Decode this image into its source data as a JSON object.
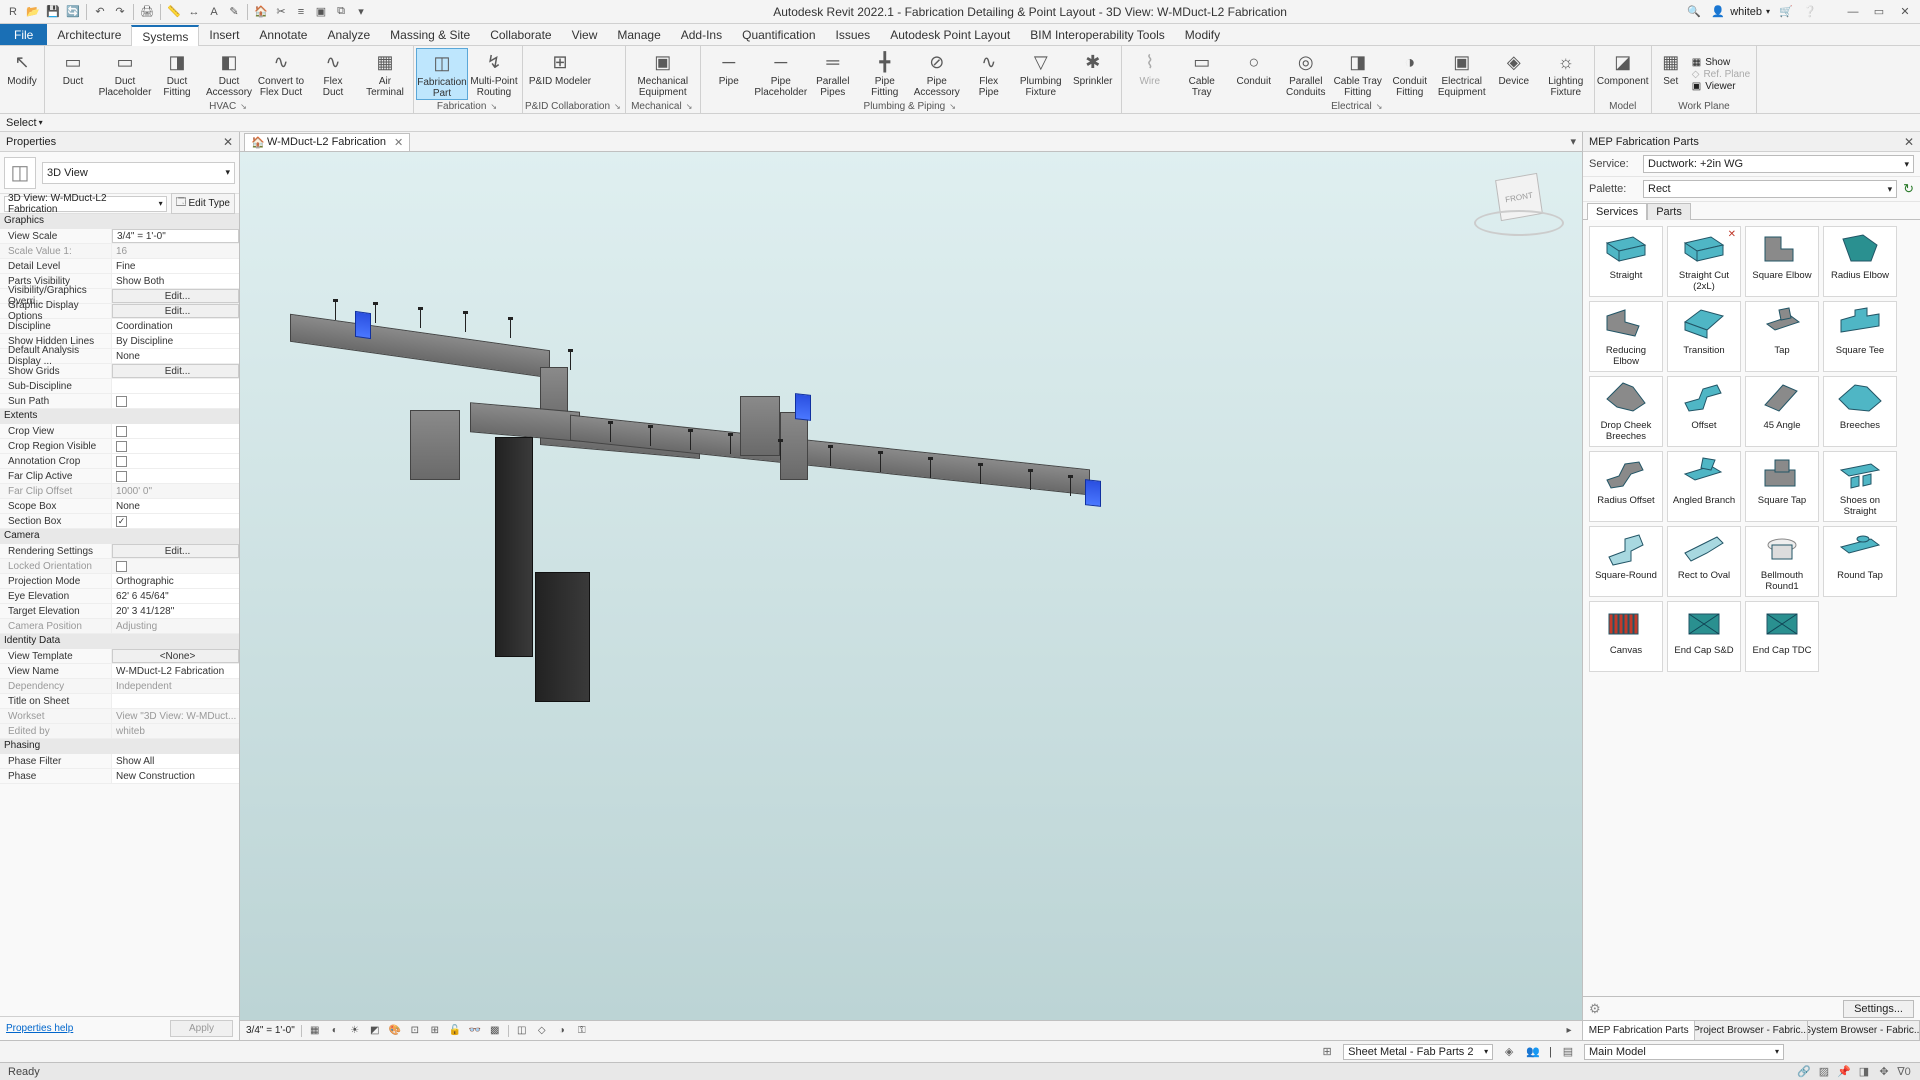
{
  "app": {
    "title": "Autodesk Revit 2022.1 - Fabrication Detailing & Point Layout - 3D View: W-MDuct-L2 Fabrication",
    "user": "whiteb"
  },
  "ribbon_tabs": [
    "Architecture",
    "Systems",
    "Insert",
    "Annotate",
    "Analyze",
    "Massing & Site",
    "Collaborate",
    "View",
    "Manage",
    "Add-Ins",
    "Quantification",
    "Issues",
    "Autodesk Point Layout",
    "BIM Interoperability Tools",
    "Modify"
  ],
  "active_tab": "Systems",
  "file_tab": "File",
  "options_bar": {
    "select": "Select"
  },
  "panels": [
    {
      "title": "HVAC",
      "launcher": true,
      "items": [
        {
          "label": "Duct",
          "glyph": "▭"
        },
        {
          "label": "Duct\nPlaceholder",
          "glyph": "▭"
        },
        {
          "label": "Duct\nFitting",
          "glyph": "◨"
        },
        {
          "label": "Duct\nAccessory",
          "glyph": "◧"
        },
        {
          "label": "Convert to\nFlex Duct",
          "glyph": "∿"
        },
        {
          "label": "Flex\nDuct",
          "glyph": "∿"
        },
        {
          "label": "Air\nTerminal",
          "glyph": "▦"
        }
      ]
    },
    {
      "title": "Fabrication",
      "launcher": true,
      "items": [
        {
          "label": "Fabrication\nPart",
          "glyph": "◫",
          "sel": true
        },
        {
          "label": "Multi-Point\nRouting",
          "glyph": "↯"
        }
      ]
    },
    {
      "title": "P&ID Collaboration",
      "launcher": true,
      "items": [
        {
          "label": "P&ID Modeler",
          "glyph": "⊞",
          "wide": true
        }
      ]
    },
    {
      "title": "Mechanical",
      "launcher": true,
      "items": [
        {
          "label": "Mechanical\nEquipment",
          "glyph": "▣",
          "wide": true
        }
      ]
    },
    {
      "title": "Plumbing & Piping",
      "launcher": true,
      "items": [
        {
          "label": "Pipe",
          "glyph": "─"
        },
        {
          "label": "Pipe\nPlaceholder",
          "glyph": "─"
        },
        {
          "label": "Parallel\nPipes",
          "glyph": "═"
        },
        {
          "label": "Pipe\nFitting",
          "glyph": "╋"
        },
        {
          "label": "Pipe\nAccessory",
          "glyph": "⊘"
        },
        {
          "label": "Flex\nPipe",
          "glyph": "∿"
        },
        {
          "label": "Plumbing\nFixture",
          "glyph": "▽"
        },
        {
          "label": "Sprinkler",
          "glyph": "✱"
        }
      ]
    },
    {
      "title": "Electrical",
      "launcher": true,
      "items": [
        {
          "label": "Wire",
          "glyph": "⌇",
          "disabled": true
        },
        {
          "label": "Cable\nTray",
          "glyph": "▭"
        },
        {
          "label": "Conduit",
          "glyph": "○"
        },
        {
          "label": "Parallel\nConduits",
          "glyph": "◎"
        },
        {
          "label": "Cable Tray\nFitting",
          "glyph": "◨"
        },
        {
          "label": "Conduit\nFitting",
          "glyph": "◑"
        },
        {
          "label": "Electrical\nEquipment",
          "glyph": "▣"
        },
        {
          "label": "Device",
          "glyph": "◈"
        },
        {
          "label": "Lighting\nFixture",
          "glyph": "☼"
        }
      ]
    },
    {
      "title": "Model",
      "items": [
        {
          "label": "Component",
          "glyph": "◪"
        }
      ]
    },
    {
      "title": "Work Plane",
      "items_small": [
        {
          "label": "Set",
          "glyph": "▦"
        },
        {
          "label": "Show",
          "glyph": "▦"
        },
        {
          "label": "Ref. Plane",
          "glyph": "◇",
          "disabled": true
        },
        {
          "label": "Viewer",
          "glyph": "▣"
        }
      ]
    }
  ],
  "modify_button": "Modify",
  "properties": {
    "title": "Properties",
    "type": "3D View",
    "instance": "3D View: W-MDuct-L2 Fabrication",
    "edit_type": "Edit Type",
    "groups": [
      {
        "name": "Graphics",
        "rows": [
          {
            "k": "View Scale",
            "v": "3/4\" = 1'-0\"",
            "t": "inbox"
          },
          {
            "k": "Scale Value   1:",
            "v": "16",
            "dim": true
          },
          {
            "k": "Detail Level",
            "v": "Fine"
          },
          {
            "k": "Parts Visibility",
            "v": "Show Both"
          },
          {
            "k": "Visibility/Graphics Overri...",
            "v": "Edit...",
            "t": "btn"
          },
          {
            "k": "Graphic Display Options",
            "v": "Edit...",
            "t": "btn"
          },
          {
            "k": "Discipline",
            "v": "Coordination"
          },
          {
            "k": "Show Hidden Lines",
            "v": "By Discipline"
          },
          {
            "k": "Default Analysis Display ...",
            "v": "None"
          },
          {
            "k": "Show Grids",
            "v": "Edit...",
            "t": "btn"
          },
          {
            "k": "Sub-Discipline",
            "v": ""
          },
          {
            "k": "Sun Path",
            "v": "",
            "t": "chk",
            "checked": false
          }
        ]
      },
      {
        "name": "Extents",
        "rows": [
          {
            "k": "Crop View",
            "v": "",
            "t": "chk",
            "checked": false
          },
          {
            "k": "Crop Region Visible",
            "v": "",
            "t": "chk",
            "checked": false
          },
          {
            "k": "Annotation Crop",
            "v": "",
            "t": "chk",
            "checked": false
          },
          {
            "k": "Far Clip Active",
            "v": "",
            "t": "chk",
            "checked": false
          },
          {
            "k": "Far Clip Offset",
            "v": "1000'   0\"",
            "dim": true
          },
          {
            "k": "Scope Box",
            "v": "None"
          },
          {
            "k": "Section Box",
            "v": "",
            "t": "chk",
            "checked": true
          }
        ]
      },
      {
        "name": "Camera",
        "rows": [
          {
            "k": "Rendering Settings",
            "v": "Edit...",
            "t": "btn"
          },
          {
            "k": "Locked Orientation",
            "v": "",
            "t": "chk",
            "checked": false,
            "dim": true
          },
          {
            "k": "Projection Mode",
            "v": "Orthographic"
          },
          {
            "k": "Eye Elevation",
            "v": "62'   6 45/64\""
          },
          {
            "k": "Target Elevation",
            "v": "20'   3 41/128\""
          },
          {
            "k": "Camera Position",
            "v": "Adjusting",
            "dim": true
          }
        ]
      },
      {
        "name": "Identity Data",
        "rows": [
          {
            "k": "View Template",
            "v": "<None>",
            "t": "btn"
          },
          {
            "k": "View Name",
            "v": "W-MDuct-L2 Fabrication"
          },
          {
            "k": "Dependency",
            "v": "Independent",
            "dim": true
          },
          {
            "k": "Title on Sheet",
            "v": ""
          },
          {
            "k": "Workset",
            "v": "View \"3D View: W-MDuct...",
            "dim": true
          },
          {
            "k": "Edited by",
            "v": "whiteb",
            "dim": true
          }
        ]
      },
      {
        "name": "Phasing",
        "rows": [
          {
            "k": "Phase Filter",
            "v": "Show All"
          },
          {
            "k": "Phase",
            "v": "New Construction"
          }
        ]
      }
    ],
    "help": "Properties help",
    "apply": "Apply"
  },
  "view": {
    "tab_name": "W-MDuct-L2 Fabrication",
    "scale_disp": "3/4\" = 1'-0\"",
    "cube_face": "FRONT"
  },
  "fab": {
    "title": "MEP Fabrication Parts",
    "service_label": "Service:",
    "service": "Ductwork: +2in WG",
    "palette_label": "Palette:",
    "palette": "Rect",
    "tabs": [
      "Services",
      "Parts"
    ],
    "parts": [
      {
        "label": "Straight",
        "c": "#4fb6c5",
        "sh": "rect"
      },
      {
        "label": "Straight Cut (2xL)",
        "c": "#4fb6c5",
        "sh": "rect",
        "del": true
      },
      {
        "label": "Square Elbow",
        "c": "#8a8a8a",
        "sh": "elbow"
      },
      {
        "label": "Radius Elbow",
        "c": "#2a9090",
        "sh": "rad"
      },
      {
        "label": "Reducing Elbow",
        "c": "#8a8a8a",
        "sh": "red-el"
      },
      {
        "label": "Transition",
        "c": "#4fb6c5",
        "sh": "trans"
      },
      {
        "label": "Tap",
        "c": "#8a8a8a",
        "sh": "tap"
      },
      {
        "label": "Square Tee",
        "c": "#4fb6c5",
        "sh": "tee"
      },
      {
        "label": "Drop Cheek Breeches",
        "c": "#8a8a8a",
        "sh": "breech"
      },
      {
        "label": "Offset",
        "c": "#4fb6c5",
        "sh": "offset"
      },
      {
        "label": "45 Angle",
        "c": "#8a8a8a",
        "sh": "ang45"
      },
      {
        "label": "Breeches",
        "c": "#4fb6c5",
        "sh": "breech2"
      },
      {
        "label": "Radius Offset",
        "c": "#8a8a8a",
        "sh": "roff"
      },
      {
        "label": "Angled Branch",
        "c": "#4fb6c5",
        "sh": "abranch"
      },
      {
        "label": "Square Tap",
        "c": "#8a8a8a",
        "sh": "sqtap"
      },
      {
        "label": "Shoes on Straight",
        "c": "#4fb6c5",
        "sh": "shoes"
      },
      {
        "label": "Square-Round",
        "c": "#a8d8e0",
        "sh": "sqrd"
      },
      {
        "label": "Rect to Oval",
        "c": "#a8d8e0",
        "sh": "r2o"
      },
      {
        "label": "Bellmouth Round1",
        "c": "#d0d0d0",
        "sh": "bell"
      },
      {
        "label": "Round Tap",
        "c": "#4fb6c5",
        "sh": "rtap"
      },
      {
        "label": "Canvas",
        "c": "#c23a2a",
        "sh": "canvas"
      },
      {
        "label": "End Cap S&D",
        "c": "#2a9090",
        "sh": "cap"
      },
      {
        "label": "End Cap TDC",
        "c": "#2a9090",
        "sh": "cap"
      }
    ],
    "settings_btn": "Settings...",
    "btabs": [
      "MEP Fabrication Parts",
      "Project Browser - Fabric...",
      "System Browser - Fabric..."
    ]
  },
  "wsbar": {
    "worksets_label": "Sheet Metal - Fab Parts 2",
    "mainmodel": "Main Model"
  },
  "status": "Ready"
}
